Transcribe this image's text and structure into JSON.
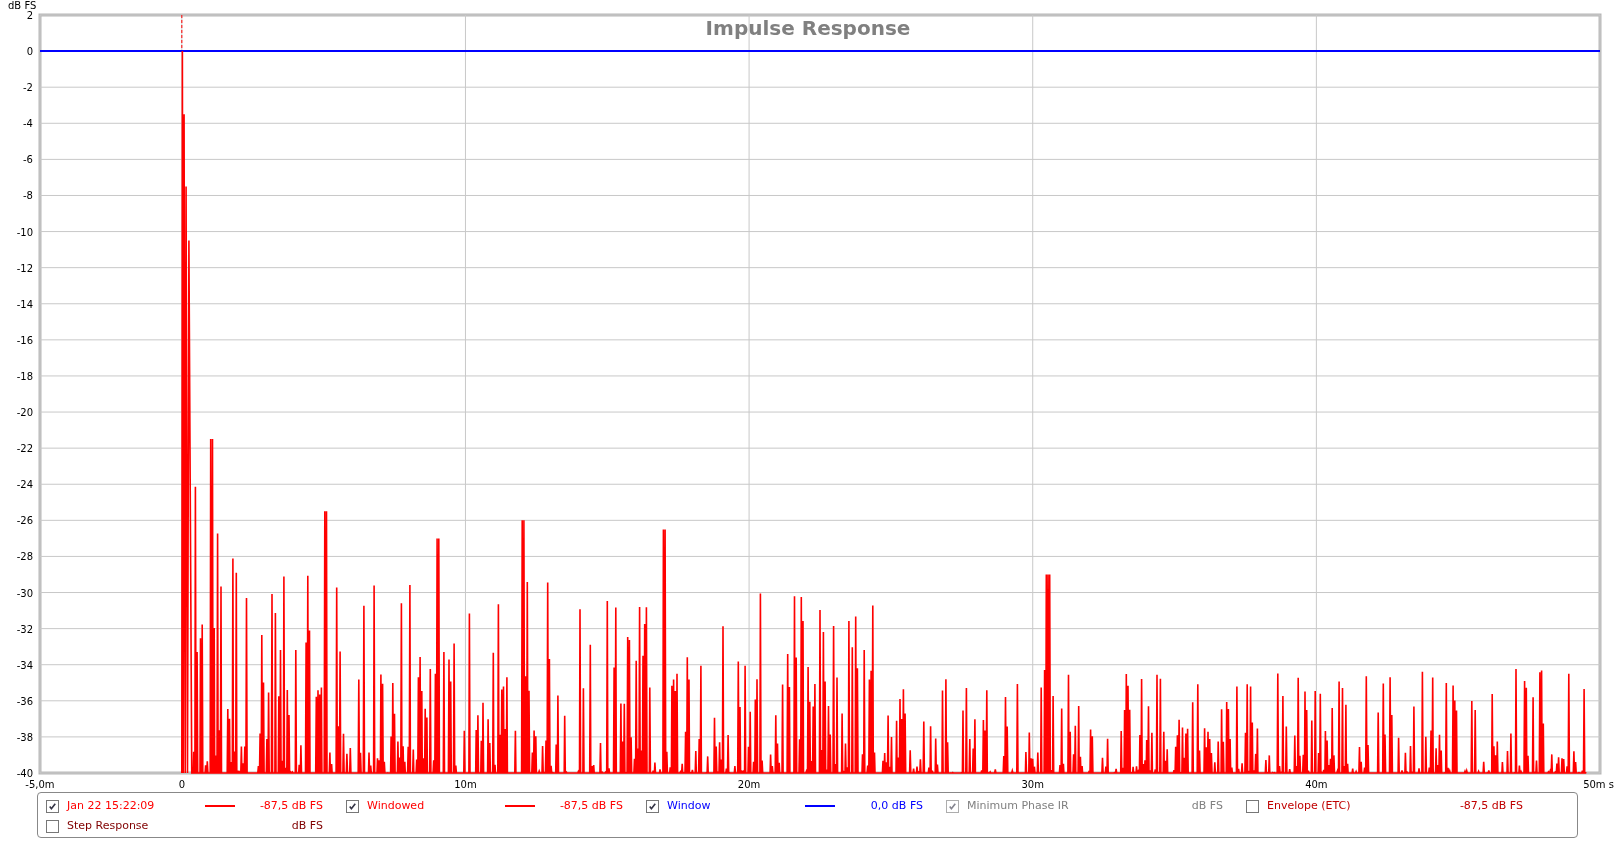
{
  "chart": {
    "chart_data": {
      "type": "line",
      "title": "Impulse Response",
      "ylabel": "dB FS",
      "xlim": [
        -5,
        50
      ],
      "ylim": [
        -40,
        2
      ],
      "xticks": [
        {
          "value": -5,
          "label": "-5,0m"
        },
        {
          "value": 0,
          "label": "0"
        },
        {
          "value": 10,
          "label": "10m"
        },
        {
          "value": 20,
          "label": "20m"
        },
        {
          "value": 30,
          "label": "30m"
        },
        {
          "value": 40,
          "label": "40m"
        },
        {
          "value": 50,
          "label": "50m s"
        }
      ],
      "yticks": [
        2,
        0,
        -2,
        -4,
        -6,
        -8,
        -10,
        -12,
        -14,
        -16,
        -18,
        -20,
        -22,
        -24,
        -26,
        -28,
        -30,
        -32,
        -34,
        -36,
        -38,
        -40
      ],
      "x": [
        -5,
        50
      ],
      "grid": true,
      "series": [
        {
          "color": "#0000ff",
          "values": [
            0,
            0
          ]
        }
      ]
    }
  },
  "legend": [
    {
      "label": "Jan 22 15:22:09",
      "checked": true,
      "disabled": false,
      "color": "#ff0000",
      "reading": "-87,5 dB FS"
    },
    {
      "label": "Windowed",
      "checked": true,
      "disabled": false,
      "color": "#ff0000",
      "reading": "-87,5 dB FS"
    },
    {
      "label": "Window",
      "checked": true,
      "disabled": false,
      "color": "#0000ff",
      "reading": "0,0 dB FS"
    },
    {
      "label": "Minimum Phase IR",
      "checked": true,
      "disabled": true,
      "color": "#808080",
      "reading": "dB FS"
    },
    {
      "label": "Envelope (ETC)",
      "checked": false,
      "disabled": false,
      "color": "#c00000",
      "reading": "-87,5 dB FS"
    },
    {
      "label": "Step Response",
      "checked": false,
      "disabled": false,
      "color": "#800000",
      "reading": "dB FS"
    }
  ]
}
